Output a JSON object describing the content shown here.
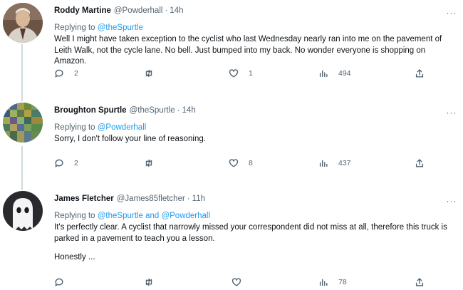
{
  "tweets": [
    {
      "name": "Roddy Martine",
      "handle": "@Powderhall",
      "time": "14h",
      "replying_prefix": "Replying to",
      "replying_to": "@theSpurtle",
      "replying_and": "",
      "replying_to_2": "",
      "text": "Well I might have taken exception to the cyclist who last Wednesday nearly ran into me on the pavement of Leith Walk, not the cycle lane. No bell. Just bumped into my back. No wonder everyone is shopping on Amazon.",
      "text_2": "",
      "replies": "2",
      "retweets": "",
      "likes": "1",
      "views": "494"
    },
    {
      "name": "Broughton Spurtle",
      "handle": "@theSpurtle",
      "time": "14h",
      "replying_prefix": "Replying to",
      "replying_to": "@Powderhall",
      "replying_and": "",
      "replying_to_2": "",
      "text": "Sorry, I don't follow your line of reasoning.",
      "text_2": "",
      "replies": "2",
      "retweets": "",
      "likes": "8",
      "views": "437"
    },
    {
      "name": "James Fletcher",
      "handle": "@James85fletcher",
      "time": "11h",
      "replying_prefix": "Replying to",
      "replying_to": "@theSpurtle",
      "replying_and": "and",
      "replying_to_2": "@Powderhall",
      "text": "It's perfectly clear. A cyclist that narrowly missed your correspondent did not miss at all, therefore this truck is parked in a pavement to teach you a lesson.",
      "text_2": "Honestly ...",
      "replies": "",
      "retweets": "",
      "likes": "",
      "views": "78"
    }
  ],
  "more_glyph": "···",
  "icons": [
    "reply-icon",
    "retweet-icon",
    "like-icon",
    "views-icon",
    "share-icon"
  ],
  "colors": {
    "link": "#1d9bf0",
    "secondary": "#536471",
    "text": "#0f1419",
    "thread_line": "#cfd9de"
  }
}
